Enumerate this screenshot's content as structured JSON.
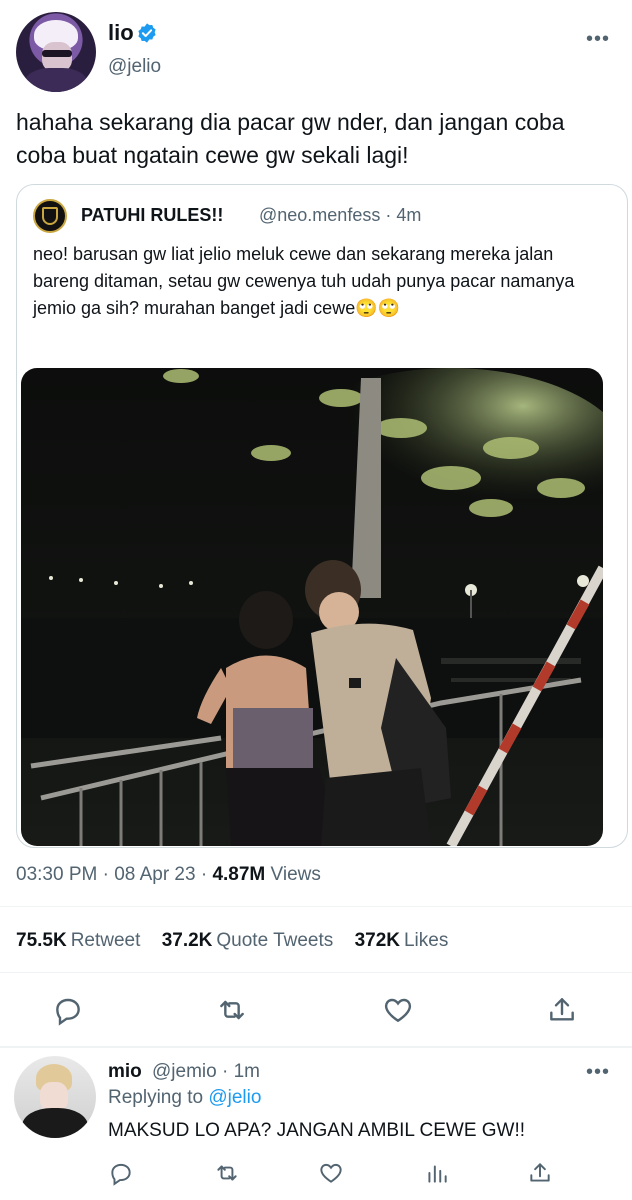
{
  "main_tweet": {
    "author_name": "lio",
    "author_handle": "@jelio",
    "more_label": "•••",
    "text": "hahaha sekarang dia pacar gw nder, dan jangan coba coba buat ngatain cewe gw sekali lagi!",
    "icons": {
      "verified": "verified-badge-icon"
    }
  },
  "quote": {
    "account_name": "PATUHI RULES!!",
    "meta": "@neo.menfess · 4m",
    "text": "neo! barusan gw liat jelio meluk cewe dan sekarang mereka jalan bareng ditaman, setau gw cewenya tuh udah punya pacar namanya jemio ga sih? murahan banget jadi cewe🙄🙄"
  },
  "timestamp": {
    "time_date": "03:30 PM · 08 Apr 23 · ",
    "views_count": "4.87M",
    "views_label": " Views"
  },
  "stats": {
    "retweets_count": "75.5K",
    "retweets_label": "Retweet",
    "quotes_count": "37.2K",
    "quotes_label": "Quote Tweets",
    "likes_count": "372K",
    "likes_label": "Likes"
  },
  "actions": [
    "reply-icon",
    "retweet-icon",
    "like-icon",
    "share-icon"
  ],
  "reply": {
    "author_name": "mio",
    "meta": "@jemio · 1m",
    "replying_prefix": "Replying to ",
    "replying_handle": "@jelio",
    "text": "MAKSUD LO APA? JANGAN AMBIL CEWE GW!!",
    "more_label": "•••",
    "actions": [
      "reply-icon",
      "retweet-icon",
      "like-icon",
      "analytics-icon",
      "share-icon"
    ]
  },
  "colors": {
    "text_primary": "#0f1419",
    "text_secondary": "#536471",
    "accent_blue": "#1d9bf0",
    "border": "#cfd9de"
  }
}
